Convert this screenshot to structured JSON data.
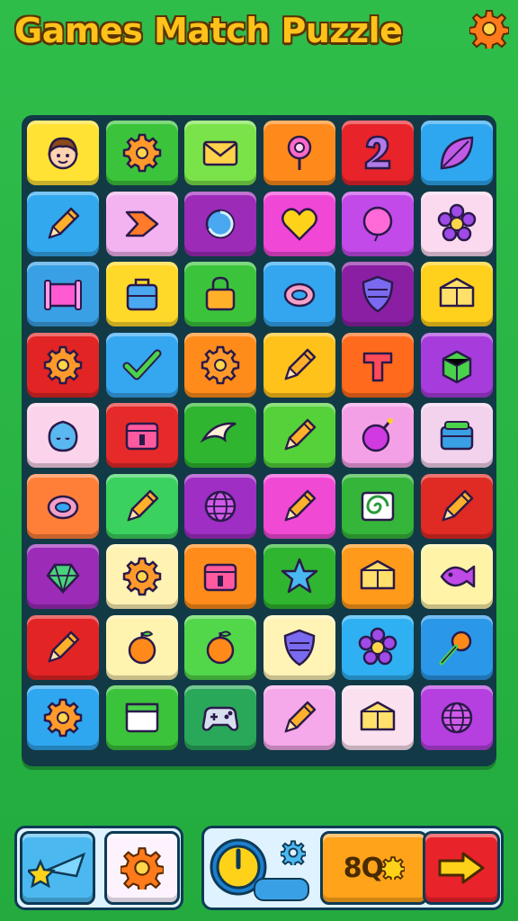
{
  "header": {
    "title": "Games Match Puzzle",
    "settings_icon": "gear-icon"
  },
  "board": {
    "rows": 9,
    "cols": 6,
    "tiles": [
      [
        "face",
        "gear",
        "envelope",
        "location-pin",
        "number-2",
        "leaf"
      ],
      [
        "pencil",
        "arrow",
        "swirl",
        "heart",
        "balloon",
        "flower"
      ],
      [
        "frame",
        "bag",
        "lock",
        "ring",
        "shield",
        "box"
      ],
      [
        "gear",
        "check",
        "gear",
        "pencil",
        "cross",
        "cube"
      ],
      [
        "blob",
        "calendar",
        "swoosh",
        "pencil",
        "bomb",
        "lunchbox"
      ],
      [
        "ring",
        "pencil",
        "globe",
        "pencil",
        "spiral",
        "pencil"
      ],
      [
        "gem",
        "gear",
        "calendar",
        "star",
        "box",
        "fish"
      ],
      [
        "pencil",
        "fruit",
        "fruit",
        "shield",
        "flower",
        "pin"
      ],
      [
        "gear",
        "window",
        "gamepad",
        "pencil",
        "box",
        "globe"
      ]
    ],
    "colors": [
      [
        "#ffe234",
        "#3bc43b",
        "#7ae34a",
        "#ff8a1c",
        "#e8232a",
        "#2fa7f0"
      ],
      [
        "#32a8ee",
        "#f2b3f0",
        "#9c2bb8",
        "#f147d6",
        "#c24ae8",
        "#fbd9ef"
      ],
      [
        "#3aa0e6",
        "#ffd92a",
        "#3bc43b",
        "#34a6f0",
        "#8a1fa3",
        "#ffd01c"
      ],
      [
        "#e32424",
        "#35a6f0",
        "#ff8c1a",
        "#ffc21a",
        "#ff6a1c",
        "#a63cdb"
      ],
      [
        "#fbd4ec",
        "#e62a2a",
        "#2fb52f",
        "#55d23a",
        "#f4a0e6",
        "#f3d2ee"
      ],
      [
        "#ff7f39",
        "#3bd15e",
        "#9e2ec4",
        "#f04ad4",
        "#35b53a",
        "#e02a24"
      ],
      [
        "#9c2bb8",
        "#fff2b3",
        "#ff8c1a",
        "#2fb52f",
        "#ff9a1a",
        "#fff3a8"
      ],
      [
        "#e32424",
        "#fff3b0",
        "#52d64a",
        "#fff4b6",
        "#2fb0f2",
        "#2b97e8"
      ],
      [
        "#2fa7f0",
        "#3bc43b",
        "#2aa85a",
        "#f5a8ea",
        "#fbe0ef",
        "#b63fe0"
      ]
    ]
  },
  "footer": {
    "left_buttons": [
      {
        "icon": "shooting-star-icon",
        "color": "#4cb8f0"
      },
      {
        "icon": "gear-icon",
        "color": "#fdf3ff"
      }
    ],
    "timer_icon": "clock-icon",
    "mini_gear_icon": "gear-icon",
    "score_text": "8Q",
    "score_icon": "gear-icon",
    "next_icon": "arrow-right-icon"
  },
  "colors": {
    "background": "#2bb845",
    "board": "#123a46",
    "title": "#ffc21a",
    "outline": "#0e3a55"
  }
}
